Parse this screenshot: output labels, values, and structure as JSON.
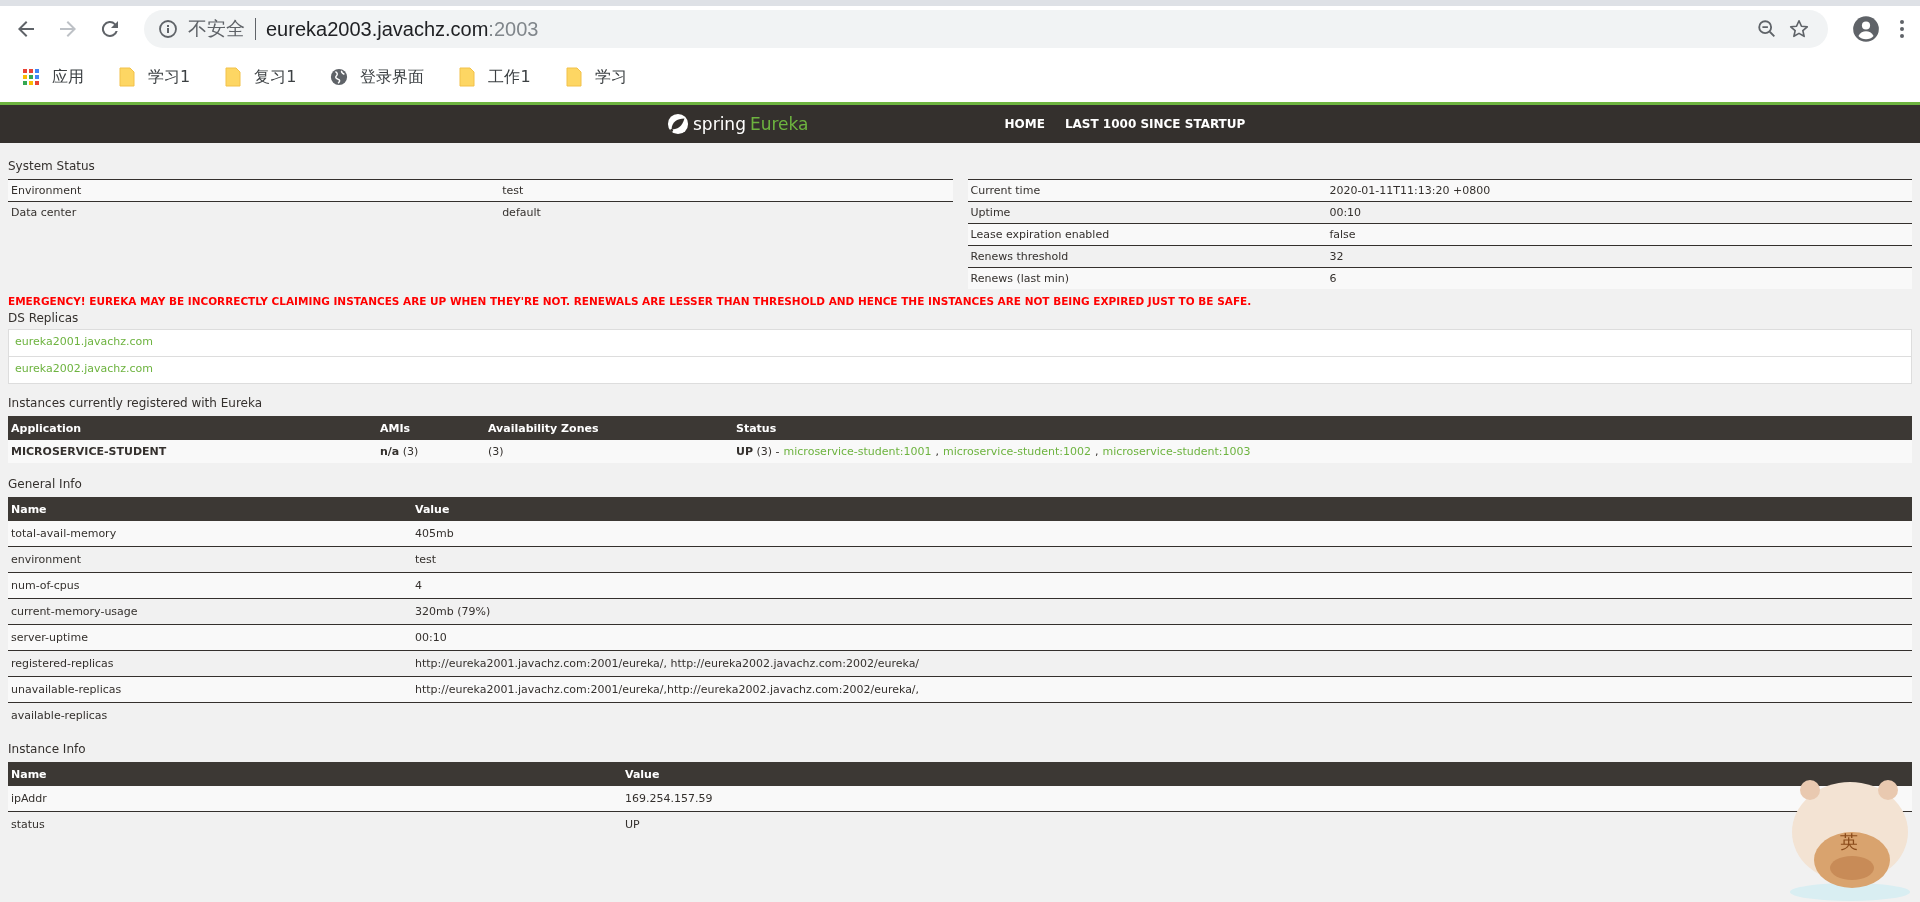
{
  "browser": {
    "back_disabled": false,
    "forward_disabled": true,
    "security_label": "不安全",
    "url_host": "eureka2003.javachz.com",
    "url_port": ":2003",
    "bookmarks": [
      {
        "label": "应用",
        "kind": "apps"
      },
      {
        "label": "学习1",
        "kind": "folder"
      },
      {
        "label": "复习1",
        "kind": "folder"
      },
      {
        "label": "登录界面",
        "kind": "globe"
      },
      {
        "label": "工作1",
        "kind": "folder"
      },
      {
        "label": "学习",
        "kind": "folder"
      }
    ]
  },
  "header": {
    "brand_word": "spring",
    "brand_name": "Eureka",
    "nav": [
      "HOME",
      "LAST 1000 SINCE STARTUP"
    ]
  },
  "system_status": {
    "title": "System Status",
    "left": [
      {
        "name": "Environment",
        "value": "test"
      },
      {
        "name": "Data center",
        "value": "default"
      }
    ],
    "right": [
      {
        "name": "Current time",
        "value": "2020-01-11T11:13:20 +0800"
      },
      {
        "name": "Uptime",
        "value": "00:10"
      },
      {
        "name": "Lease expiration enabled",
        "value": "false"
      },
      {
        "name": "Renews threshold",
        "value": "32"
      },
      {
        "name": "Renews (last min)",
        "value": "6"
      }
    ]
  },
  "emergency": "EMERGENCY! EUREKA MAY BE INCORRECTLY CLAIMING INSTANCES ARE UP WHEN THEY'RE NOT. RENEWALS ARE LESSER THAN THRESHOLD AND HENCE THE INSTANCES ARE NOT BEING EXPIRED JUST TO BE SAFE.",
  "ds_replicas": {
    "title": "DS Replicas",
    "items": [
      "eureka2001.javachz.com",
      "eureka2002.javachz.com"
    ]
  },
  "instances": {
    "title": "Instances currently registered with Eureka",
    "columns": [
      "Application",
      "AMIs",
      "Availability Zones",
      "Status"
    ],
    "rows": [
      {
        "application": "MICROSERVICE-STUDENT",
        "amis": "**n/a** (3)",
        "zones": "(3)",
        "status": "**UP** (3) -",
        "link_separator": ",",
        "links": [
          "microservice-student:1001",
          "microservice-student:1002",
          "microservice-student:1003"
        ]
      }
    ]
  },
  "general_info": {
    "title": "General Info",
    "columns": [
      "Name",
      "Value"
    ],
    "rows": [
      {
        "name": "total-avail-memory",
        "value": "405mb"
      },
      {
        "name": "environment",
        "value": "test"
      },
      {
        "name": "num-of-cpus",
        "value": "4"
      },
      {
        "name": "current-memory-usage",
        "value": "320mb (79%)"
      },
      {
        "name": "server-uptime",
        "value": "00:10"
      },
      {
        "name": "registered-replicas",
        "value": "http://eureka2001.javachz.com:2001/eureka/, http://eureka2002.javachz.com:2002/eureka/"
      },
      {
        "name": "unavailable-replicas",
        "value": "http://eureka2001.javachz.com:2001/eureka/,http://eureka2002.javachz.com:2002/eureka/,"
      },
      {
        "name": "available-replicas",
        "value": ""
      }
    ]
  },
  "instance_info": {
    "title": "Instance Info",
    "columns": [
      "Name",
      "Value"
    ],
    "rows": [
      {
        "name": "ipAddr",
        "value": "169.254.157.59"
      },
      {
        "name": "status",
        "value": "UP"
      }
    ]
  },
  "mascot": {
    "badge": "英"
  }
}
